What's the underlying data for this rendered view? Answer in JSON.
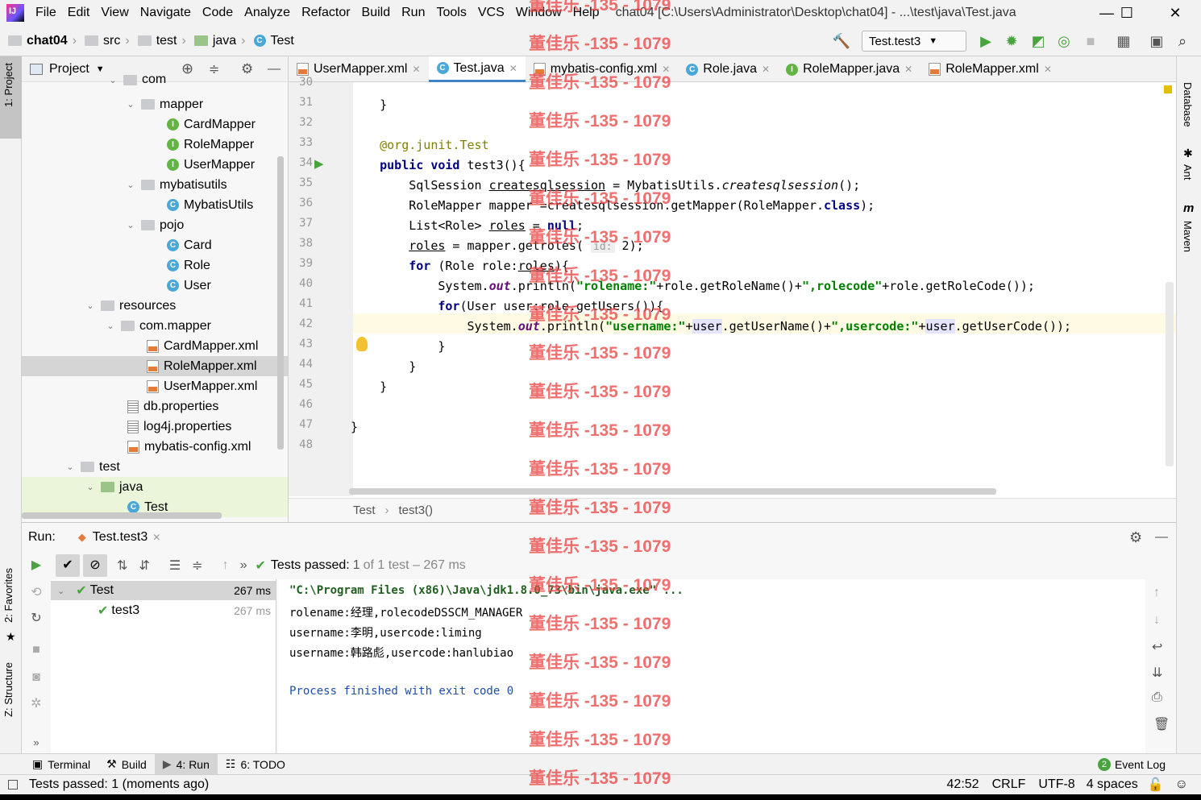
{
  "menubar": {
    "items": [
      "File",
      "Edit",
      "View",
      "Navigate",
      "Code",
      "Analyze",
      "Refactor",
      "Build",
      "Run",
      "Tools",
      "VCS",
      "Window",
      "Help"
    ],
    "title": "chat04 [C:\\Users\\Administrator\\Desktop\\chat04] - ...\\test\\java\\Test.java",
    "minimize": "—",
    "maximize": "☐",
    "close": "✕"
  },
  "navbar": {
    "crumbs": [
      "chat04",
      "src",
      "test",
      "java",
      "Test"
    ],
    "run_config": "Test.test3"
  },
  "left_strip": {
    "project": "1: Project",
    "favorites": "2: Favorites",
    "structure": "Z: Structure"
  },
  "right_strip": {
    "database": "Database",
    "ant": "Ant",
    "maven": "Maven"
  },
  "project": {
    "title": "Project",
    "items": [
      {
        "label": "com",
        "type": "folder"
      },
      {
        "label": "mapper",
        "type": "folder"
      },
      {
        "label": "CardMapper",
        "type": "interface"
      },
      {
        "label": "RoleMapper",
        "type": "interface"
      },
      {
        "label": "UserMapper",
        "type": "interface"
      },
      {
        "label": "mybatisutils",
        "type": "folder"
      },
      {
        "label": "MybatisUtils",
        "type": "class"
      },
      {
        "label": "pojo",
        "type": "folder"
      },
      {
        "label": "Card",
        "type": "class"
      },
      {
        "label": "Role",
        "type": "class"
      },
      {
        "label": "User",
        "type": "class"
      },
      {
        "label": "resources",
        "type": "folder"
      },
      {
        "label": "com.mapper",
        "type": "folder"
      },
      {
        "label": "CardMapper.xml",
        "type": "xml"
      },
      {
        "label": "RoleMapper.xml",
        "type": "xml"
      },
      {
        "label": "UserMapper.xml",
        "type": "xml"
      },
      {
        "label": "db.properties",
        "type": "props"
      },
      {
        "label": "log4j.properties",
        "type": "props"
      },
      {
        "label": "mybatis-config.xml",
        "type": "xml"
      },
      {
        "label": "test",
        "type": "folder"
      },
      {
        "label": "java",
        "type": "folder"
      },
      {
        "label": "Test",
        "type": "class"
      }
    ]
  },
  "editor": {
    "tabs": [
      "UserMapper.xml",
      "Test.java",
      "mybatis-config.xml",
      "Role.java",
      "RoleMapper.java",
      "RoleMapper.xml"
    ],
    "line_numbers": [
      "30",
      "31",
      "32",
      "33",
      "34",
      "35",
      "36",
      "37",
      "38",
      "39",
      "40",
      "41",
      "42",
      "43",
      "44",
      "45",
      "46",
      "47",
      "48"
    ],
    "hint": "id:",
    "breadcrumb": [
      "Test",
      "test3()"
    ]
  },
  "run": {
    "label": "Run:",
    "tab": "Test.test3",
    "status": "Tests passed:",
    "status_count": "1",
    "status_rest": "of 1 test – 267 ms",
    "tree": [
      {
        "name": "Test",
        "time": "267 ms"
      },
      {
        "name": "test3",
        "time": "267 ms"
      }
    ],
    "console": [
      "\"C:\\Program Files (x86)\\Java\\jdk1.8.0_73\\bin\\java.exe\" ...",
      "rolename:经理,rolecodeDSSCM_MANAGER",
      "username:李明,usercode:liming",
      "username:韩路彪,usercode:hanlubiao",
      "",
      "Process finished with exit code 0"
    ]
  },
  "bottom_tabs": [
    "Terminal",
    "Build",
    "4: Run",
    "6: TODO"
  ],
  "event_log": "Event Log",
  "event_count": "2",
  "status": {
    "message": "Tests passed: 1 (moments ago)",
    "position": "42:52",
    "line_sep": "CRLF",
    "encoding": "UTF-8",
    "indent": "4 spaces"
  },
  "watermark": "董佳乐 -135 - 1079"
}
